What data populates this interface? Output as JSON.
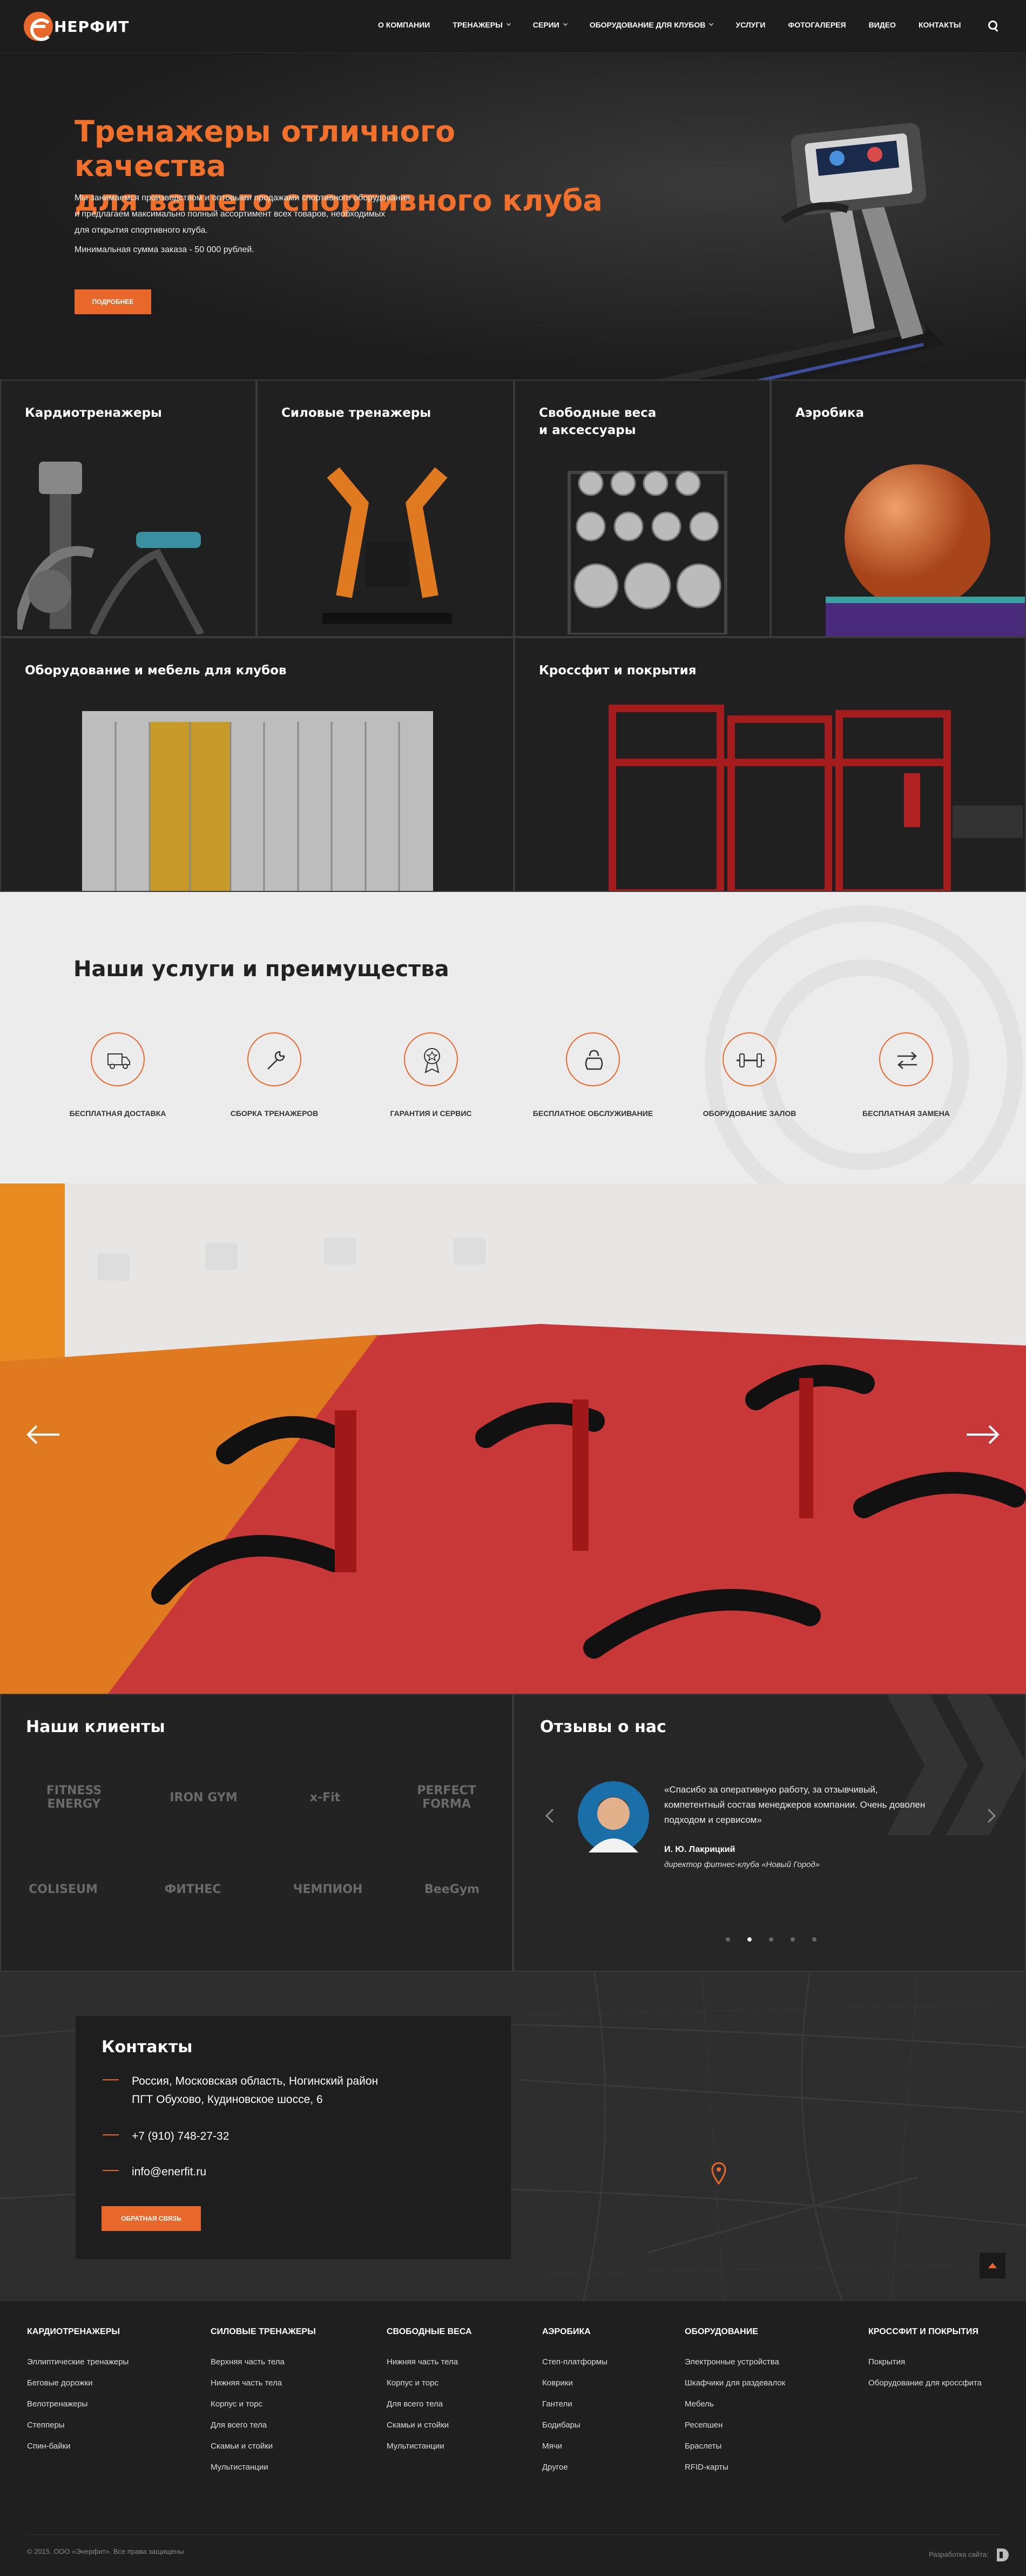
{
  "header": {
    "logo_text": "НЕРФИТ",
    "nav": [
      {
        "label": "О компании",
        "dropdown": false
      },
      {
        "label": "Тренажеры",
        "dropdown": true
      },
      {
        "label": "Серии",
        "dropdown": true
      },
      {
        "label": "Оборудование для клубов",
        "dropdown": true
      },
      {
        "label": "Услуги",
        "dropdown": false
      },
      {
        "label": "Фотогалерея",
        "dropdown": false
      },
      {
        "label": "Видео",
        "dropdown": false
      },
      {
        "label": "Контакты",
        "dropdown": false
      }
    ],
    "search_icon": "search-icon"
  },
  "hero": {
    "title_line1": "Тренажеры отличного качества",
    "title_line2": "для вашего спортивного клуба",
    "text_line1": "Мы занимаемся производством и оптовыми продажами спортивного оборудования",
    "text_line2": "и предлагаем максимально полный ассортимент всех товаров, необходимых",
    "text_line3": "для открытия спортивного клуба.",
    "min_order": "Минимальная сумма заказа - 50 000 рублей.",
    "button": "Подробнее"
  },
  "categories": {
    "cardio": "Кардиотренажеры",
    "strength": "Силовые тренажеры",
    "free_weights_line1": "Свободные веса",
    "free_weights_line2": "и аксессуары",
    "aerobics": "Аэробика",
    "club_equipment": "Оборудование и мебель для клубов",
    "crossfit": "Кроссфит и покрытия"
  },
  "services": {
    "title": "Наши услуги и преимущества",
    "items": [
      {
        "label": "Бесплатная доставка",
        "icon": "truck-icon"
      },
      {
        "label": "Сборка тренажеров",
        "icon": "wrench-icon"
      },
      {
        "label": "Гарантия и сервис",
        "icon": "medal-icon"
      },
      {
        "label": "Бесплатное обслуживание",
        "icon": "kettlebell-icon"
      },
      {
        "label": "Оборудование залов",
        "icon": "dumbbell-icon"
      },
      {
        "label": "Бесплатная замена",
        "icon": "swap-arrows-icon"
      }
    ]
  },
  "clients": {
    "title": "Наши клиенты",
    "logos": [
      "FITNESS ENERGY",
      "IRON GYM",
      "x-Fit",
      "PERFECT FORMA",
      "COLISEUM",
      "ФИТНЕС",
      "ЧЕМПИОН",
      "BeeGym"
    ]
  },
  "reviews": {
    "title": "Отзывы о нас",
    "quote_line1": "«Спасибо за оперативную работу, за отзывчивый,",
    "quote_line2": "компетентный состав менеджеров компании. Очень доволен",
    "quote_line3": "подходом и сервисом»",
    "author": "И. Ю. Лакрицкий",
    "position": "директор фитнес-клуба «Новый Город»",
    "dots": 5,
    "active_dot": 2
  },
  "contacts": {
    "title": "Контакты",
    "address_line1": "Россия, Московская область, Ногинский район",
    "address_line2": "ПГТ Обухово, Кудиновское шоссе, 6",
    "phone": "+7 (910) 748-27-32",
    "email": "info@enerfit.ru",
    "button": "Обратная связь"
  },
  "footer": {
    "columns": [
      {
        "title": "Кардиотренажеры",
        "links": [
          "Эллиптические тренажеры",
          "Беговые дорожки",
          "Велотренажеры",
          "Степперы",
          "Спин-байки"
        ]
      },
      {
        "title": "Силовые тренажеры",
        "links": [
          "Верхняя часть тела",
          "Нижняя часть тела",
          "Корпус и торс",
          "Для всего тела",
          "Скамьи и стойки",
          "Мультистанции"
        ]
      },
      {
        "title": "Свободные веса",
        "links": [
          "Нижняя часть тела",
          "Корпус и торс",
          "Для всего тела",
          "Скамьи и стойки",
          "Мультистанции"
        ]
      },
      {
        "title": "Аэробика",
        "links": [
          "Степ-платформы",
          "Коврики",
          "Гантели",
          "Бодибары",
          "Мячи",
          "Другое"
        ]
      },
      {
        "title": "Оборудование",
        "links": [
          "Электронные устройства",
          "Шкафчики для раздевалок",
          "Мебель",
          "Ресепшен",
          "Браслеты",
          "RFID-карты"
        ]
      },
      {
        "title": "Кроссфит и покрытия",
        "links": [
          "Покрытия",
          "Оборудование для кроссфита"
        ]
      }
    ],
    "copyright": "© 2015. ООО «Энерфит». Все права защищены",
    "developer": "Разработка сайта:"
  },
  "colors": {
    "accent": "#e8682c",
    "dark": "#262626",
    "light": "#ececec"
  }
}
